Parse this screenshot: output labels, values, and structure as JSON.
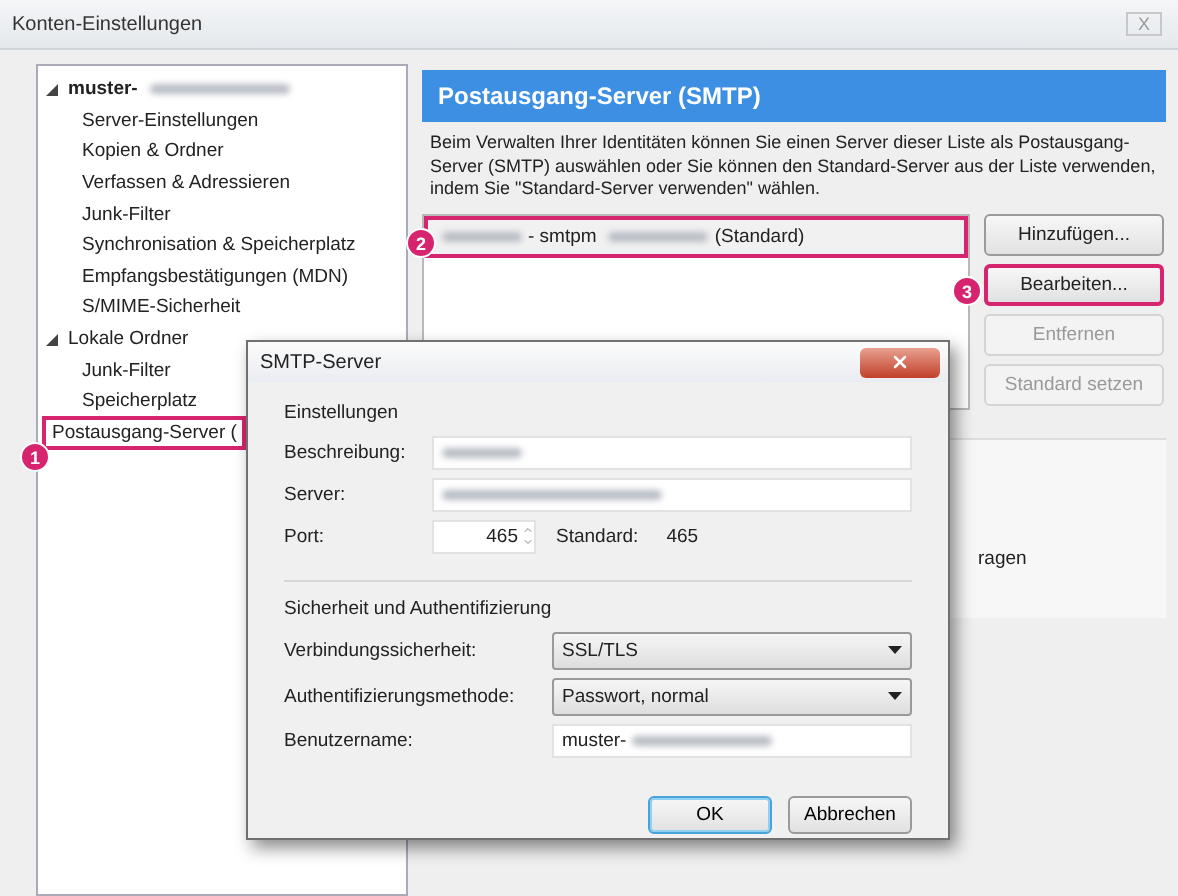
{
  "window": {
    "title": "Konten-Einstellungen",
    "close": "X"
  },
  "tree": [
    {
      "label": "muster-",
      "redacted": true,
      "bold": true,
      "expanded": true,
      "highlighted": false,
      "children": [
        {
          "label": "Server-Einstellungen",
          "highlighted": false
        },
        {
          "label": "Kopien & Ordner",
          "highlighted": false
        },
        {
          "label": "Verfassen & Adressieren",
          "highlighted": false
        },
        {
          "label": "Junk-Filter",
          "highlighted": false
        },
        {
          "label": "Synchronisation & Speicherplatz",
          "highlighted": false
        },
        {
          "label": "Empfangsbestätigungen (MDN)",
          "highlighted": false
        },
        {
          "label": "S/MIME-Sicherheit",
          "highlighted": false
        }
      ]
    },
    {
      "label": "Lokale Ordner",
      "redacted": false,
      "bold": false,
      "expanded": true,
      "highlighted": false,
      "children": [
        {
          "label": "Junk-Filter",
          "highlighted": false
        },
        {
          "label": "Speicherplatz",
          "highlighted": false
        }
      ]
    },
    {
      "label": "Postausgang-Server (",
      "redacted": false,
      "bold": false,
      "expanded": false,
      "highlighted": true
    }
  ],
  "panel": {
    "heading": "Postausgang-Server (SMTP)",
    "description": "Beim Verwalten Ihrer Identitäten können Sie einen Server dieser Liste als Postausgang-Server (SMTP) auswählen oder Sie können den Standard-Server aus der Liste verwenden, indem Sie \"Standard-Server verwenden\" wählen.",
    "servers": [
      {
        "prefix": "- smtpm",
        "suffix": "(Standard)",
        "highlighted": true
      }
    ],
    "buttons": [
      {
        "label": "Hinzufügen...",
        "disabled": false,
        "highlighted": false
      },
      {
        "label": "Bearbeiten...",
        "disabled": false,
        "highlighted": true
      },
      {
        "label": "Entfernen",
        "disabled": true,
        "highlighted": false
      },
      {
        "label": "Standard setzen",
        "disabled": true,
        "highlighted": false
      }
    ],
    "details_fragment": "ragen"
  },
  "dialog": {
    "title": "SMTP-Server",
    "group_1": "Einstellungen",
    "fields": [
      {
        "label": "Beschreibung:",
        "redacted": true
      },
      {
        "label": "Server:",
        "redacted": true
      }
    ],
    "port": {
      "label": "Port:",
      "value": "465",
      "default_label": "Standard:",
      "default_value": "465"
    },
    "group_2": "Sicherheit und Authentifizierung",
    "selects": [
      {
        "label": "Verbindungssicherheit:",
        "value": "SSL/TLS"
      },
      {
        "label": "Authentifizierungsmethode:",
        "value": "Passwort, normal"
      }
    ],
    "username": {
      "label": "Benutzername:",
      "value": "muster-",
      "redacted": true
    },
    "buttons": [
      {
        "label": "OK",
        "focused": true
      },
      {
        "label": "Abbrechen",
        "focused": false
      }
    ]
  },
  "annotations": [
    {
      "number": "1"
    },
    {
      "number": "2"
    },
    {
      "number": "3"
    }
  ]
}
